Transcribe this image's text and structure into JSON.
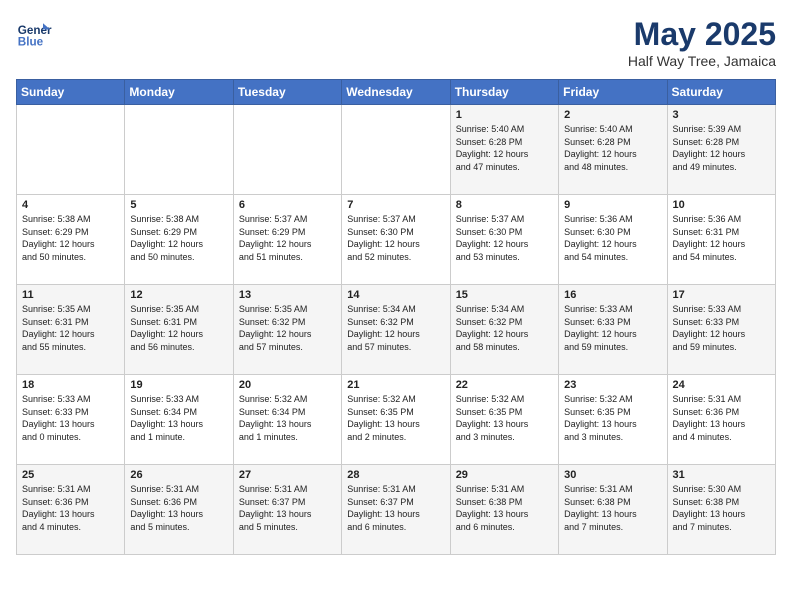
{
  "header": {
    "logo_line1": "General",
    "logo_line2": "Blue",
    "month": "May 2025",
    "location": "Half Way Tree, Jamaica"
  },
  "weekdays": [
    "Sunday",
    "Monday",
    "Tuesday",
    "Wednesday",
    "Thursday",
    "Friday",
    "Saturday"
  ],
  "weeks": [
    [
      {
        "day": "",
        "info": ""
      },
      {
        "day": "",
        "info": ""
      },
      {
        "day": "",
        "info": ""
      },
      {
        "day": "",
        "info": ""
      },
      {
        "day": "1",
        "info": "Sunrise: 5:40 AM\nSunset: 6:28 PM\nDaylight: 12 hours\nand 47 minutes."
      },
      {
        "day": "2",
        "info": "Sunrise: 5:40 AM\nSunset: 6:28 PM\nDaylight: 12 hours\nand 48 minutes."
      },
      {
        "day": "3",
        "info": "Sunrise: 5:39 AM\nSunset: 6:28 PM\nDaylight: 12 hours\nand 49 minutes."
      }
    ],
    [
      {
        "day": "4",
        "info": "Sunrise: 5:38 AM\nSunset: 6:29 PM\nDaylight: 12 hours\nand 50 minutes."
      },
      {
        "day": "5",
        "info": "Sunrise: 5:38 AM\nSunset: 6:29 PM\nDaylight: 12 hours\nand 50 minutes."
      },
      {
        "day": "6",
        "info": "Sunrise: 5:37 AM\nSunset: 6:29 PM\nDaylight: 12 hours\nand 51 minutes."
      },
      {
        "day": "7",
        "info": "Sunrise: 5:37 AM\nSunset: 6:30 PM\nDaylight: 12 hours\nand 52 minutes."
      },
      {
        "day": "8",
        "info": "Sunrise: 5:37 AM\nSunset: 6:30 PM\nDaylight: 12 hours\nand 53 minutes."
      },
      {
        "day": "9",
        "info": "Sunrise: 5:36 AM\nSunset: 6:30 PM\nDaylight: 12 hours\nand 54 minutes."
      },
      {
        "day": "10",
        "info": "Sunrise: 5:36 AM\nSunset: 6:31 PM\nDaylight: 12 hours\nand 54 minutes."
      }
    ],
    [
      {
        "day": "11",
        "info": "Sunrise: 5:35 AM\nSunset: 6:31 PM\nDaylight: 12 hours\nand 55 minutes."
      },
      {
        "day": "12",
        "info": "Sunrise: 5:35 AM\nSunset: 6:31 PM\nDaylight: 12 hours\nand 56 minutes."
      },
      {
        "day": "13",
        "info": "Sunrise: 5:35 AM\nSunset: 6:32 PM\nDaylight: 12 hours\nand 57 minutes."
      },
      {
        "day": "14",
        "info": "Sunrise: 5:34 AM\nSunset: 6:32 PM\nDaylight: 12 hours\nand 57 minutes."
      },
      {
        "day": "15",
        "info": "Sunrise: 5:34 AM\nSunset: 6:32 PM\nDaylight: 12 hours\nand 58 minutes."
      },
      {
        "day": "16",
        "info": "Sunrise: 5:33 AM\nSunset: 6:33 PM\nDaylight: 12 hours\nand 59 minutes."
      },
      {
        "day": "17",
        "info": "Sunrise: 5:33 AM\nSunset: 6:33 PM\nDaylight: 12 hours\nand 59 minutes."
      }
    ],
    [
      {
        "day": "18",
        "info": "Sunrise: 5:33 AM\nSunset: 6:33 PM\nDaylight: 13 hours\nand 0 minutes."
      },
      {
        "day": "19",
        "info": "Sunrise: 5:33 AM\nSunset: 6:34 PM\nDaylight: 13 hours\nand 1 minute."
      },
      {
        "day": "20",
        "info": "Sunrise: 5:32 AM\nSunset: 6:34 PM\nDaylight: 13 hours\nand 1 minutes."
      },
      {
        "day": "21",
        "info": "Sunrise: 5:32 AM\nSunset: 6:35 PM\nDaylight: 13 hours\nand 2 minutes."
      },
      {
        "day": "22",
        "info": "Sunrise: 5:32 AM\nSunset: 6:35 PM\nDaylight: 13 hours\nand 3 minutes."
      },
      {
        "day": "23",
        "info": "Sunrise: 5:32 AM\nSunset: 6:35 PM\nDaylight: 13 hours\nand 3 minutes."
      },
      {
        "day": "24",
        "info": "Sunrise: 5:31 AM\nSunset: 6:36 PM\nDaylight: 13 hours\nand 4 minutes."
      }
    ],
    [
      {
        "day": "25",
        "info": "Sunrise: 5:31 AM\nSunset: 6:36 PM\nDaylight: 13 hours\nand 4 minutes."
      },
      {
        "day": "26",
        "info": "Sunrise: 5:31 AM\nSunset: 6:36 PM\nDaylight: 13 hours\nand 5 minutes."
      },
      {
        "day": "27",
        "info": "Sunrise: 5:31 AM\nSunset: 6:37 PM\nDaylight: 13 hours\nand 5 minutes."
      },
      {
        "day": "28",
        "info": "Sunrise: 5:31 AM\nSunset: 6:37 PM\nDaylight: 13 hours\nand 6 minutes."
      },
      {
        "day": "29",
        "info": "Sunrise: 5:31 AM\nSunset: 6:38 PM\nDaylight: 13 hours\nand 6 minutes."
      },
      {
        "day": "30",
        "info": "Sunrise: 5:31 AM\nSunset: 6:38 PM\nDaylight: 13 hours\nand 7 minutes."
      },
      {
        "day": "31",
        "info": "Sunrise: 5:30 AM\nSunset: 6:38 PM\nDaylight: 13 hours\nand 7 minutes."
      }
    ]
  ]
}
